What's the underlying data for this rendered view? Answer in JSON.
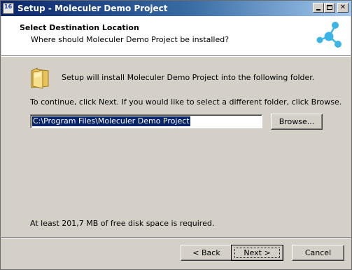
{
  "window": {
    "title": "Setup - Moleculer Demo Project",
    "icon_label": "16",
    "controls": {
      "minimize": "minimize-icon",
      "maximize": "maximize-icon",
      "close": "close-icon",
      "close_glyph": "✕"
    }
  },
  "header": {
    "title": "Select Destination Location",
    "subtitle": "Where should Moleculer Demo Project be installed?",
    "logo": "molecule-logo-icon",
    "logo_color": "#3cb4e6"
  },
  "body": {
    "folder_icon": "folder-icon",
    "install_text": "Setup will install Moleculer Demo Project into the following folder.",
    "continue_text": "To continue, click Next. If you would like to select a different folder, click Browse.",
    "destination_path": "C:\\Program Files\\Moleculer Demo Project",
    "browse_label": "Browse...",
    "disk_space_text": "At least 201,7 MB of free disk space is required."
  },
  "footer": {
    "back_label": "< Back",
    "next_label": "Next >",
    "cancel_label": "Cancel"
  },
  "colors": {
    "titlebar_start": "#0a246a",
    "titlebar_end": "#a6caf0",
    "dialog_bg": "#d4d0c8",
    "selection": "#0a246a"
  }
}
